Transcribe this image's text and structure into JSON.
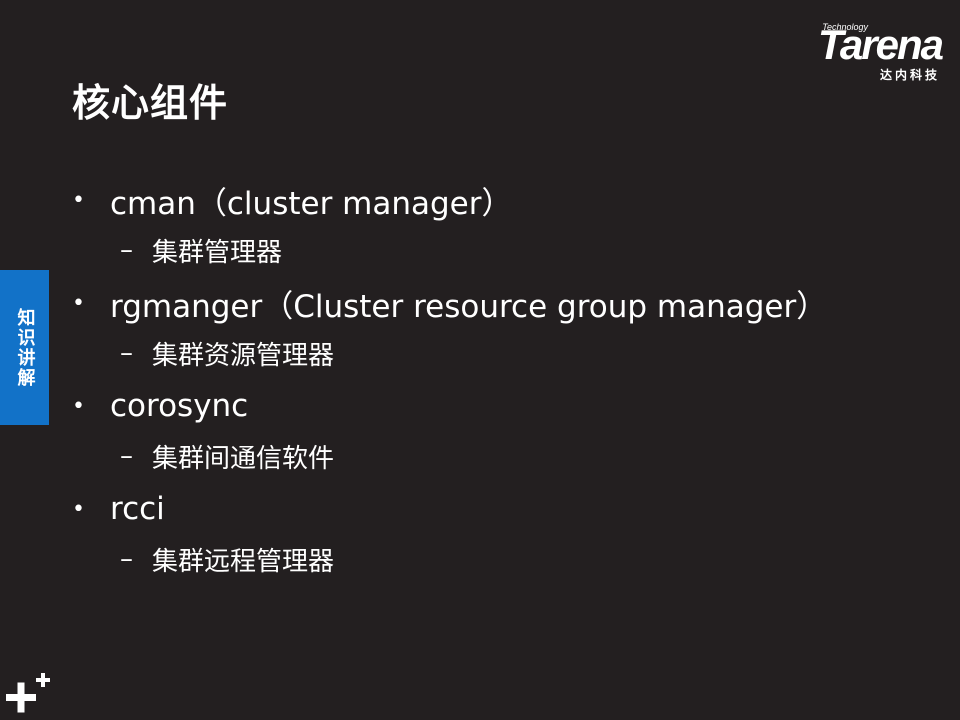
{
  "title": "核心组件",
  "logo": {
    "small_text": "Technology",
    "wordmark": "Tarena",
    "chinese": "达内科技"
  },
  "side_tab": {
    "label": "知识讲解"
  },
  "bullets": [
    {
      "marker": "•",
      "text": "cman（cluster manager）",
      "sub_marker": "–",
      "sub": "集群管理器"
    },
    {
      "marker": "•",
      "text": "rgmanger（Cluster resource group manager）",
      "sub_marker": "–",
      "sub": "集群资源管理器"
    },
    {
      "marker": "•",
      "text": "corosync",
      "sub_marker": "–",
      "sub": "集群间通信软件"
    },
    {
      "marker": "•",
      "text": "rcci",
      "sub_marker": "–",
      "sub": "集群远程管理器"
    }
  ],
  "colors": {
    "background": "#231f20",
    "accent": "#1272c8",
    "text": "#ffffff"
  },
  "icons": {
    "corner": "plus-icon"
  }
}
